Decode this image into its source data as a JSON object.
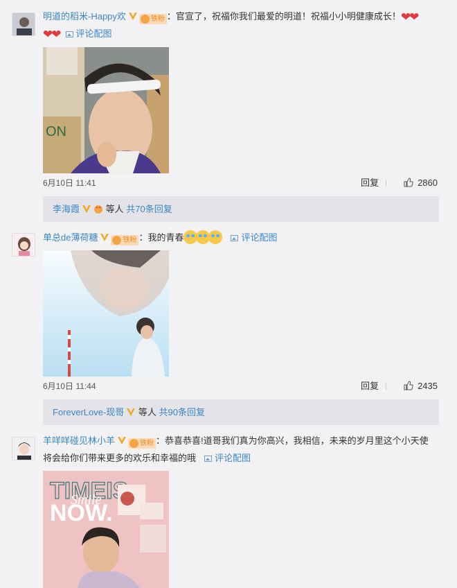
{
  "comments": [
    {
      "username": "明道的稻米-Happy欢",
      "fan_badge": "铁粉",
      "text": "：官宣了，祝福你我们最爱的明道！祝福小小明健康成长！",
      "hearts": "❤❤",
      "hearts2": "❤❤",
      "pic_link": "评论配图",
      "time": "6月10日 11:41",
      "reply_label": "回复",
      "likes": "2860",
      "reply_user": "李海霞",
      "reply_suffix": " 等人 ",
      "reply_total": "共70条回复"
    },
    {
      "username": "单总de薄荷糖",
      "fan_badge": "铁粉",
      "text": "：我的青春",
      "pic_link": "评论配图",
      "time": "6月10日 11:44",
      "reply_label": "回复",
      "likes": "2435",
      "reply_user": "ForeverLove-现哥",
      "reply_suffix": " 等人 ",
      "reply_total": "共90条回复"
    },
    {
      "username": "羊咩咩碰见林小羊",
      "fan_badge": "铁粉",
      "text": "：恭喜恭喜!道哥我们真为你高兴，我相信，未来的岁月里这个小天使",
      "text2": "将会给你们带来更多的欢乐和幸福的哦",
      "pic_link": "评论配图",
      "photo_title1": "TIMEIS",
      "photo_title2": "NOW.",
      "photo_script": "Smile"
    }
  ],
  "colors": {
    "username": "#eb7350",
    "link": "#3a86c4",
    "background": "#f2f2f5",
    "reply_box": "#e4e4e8"
  }
}
